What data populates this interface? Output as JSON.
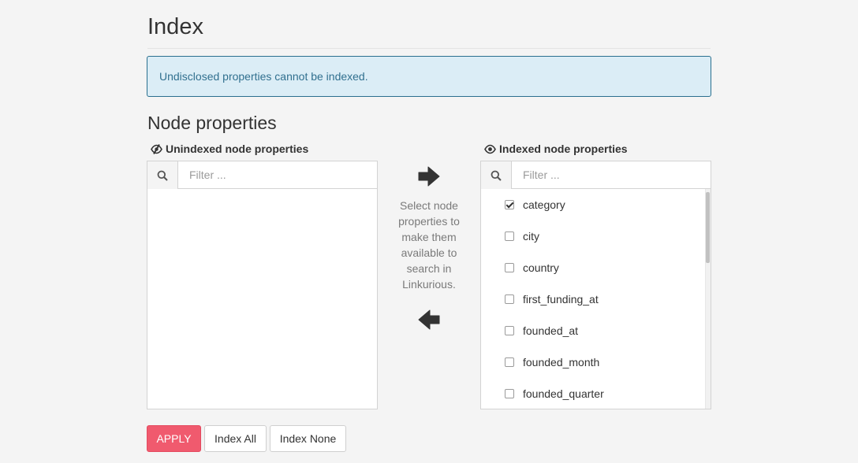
{
  "page": {
    "title": "Index"
  },
  "alert": {
    "text": "Undisclosed properties cannot be indexed."
  },
  "section": {
    "title": "Node properties"
  },
  "unindexed": {
    "heading": "Unindexed node properties",
    "filter_placeholder": "Filter ...",
    "filter_value": ""
  },
  "indexed": {
    "heading": "Indexed node properties",
    "filter_placeholder": "Filter ...",
    "filter_value": "",
    "items": [
      {
        "label": "category",
        "checked": true
      },
      {
        "label": "city",
        "checked": false
      },
      {
        "label": "country",
        "checked": false
      },
      {
        "label": "first_funding_at",
        "checked": false
      },
      {
        "label": "founded_at",
        "checked": false
      },
      {
        "label": "founded_month",
        "checked": false
      },
      {
        "label": "founded_quarter",
        "checked": false
      }
    ]
  },
  "transfer": {
    "help_text": "Select node properties to make them available to search in Linkurious.",
    "right_icon": "arrow-right-icon",
    "left_icon": "arrow-left-icon"
  },
  "buttons": {
    "apply": "APPLY",
    "index_all": "Index All",
    "index_none": "Index None"
  },
  "colors": {
    "primary": "#f05a6e",
    "alert_bg": "#dbedf6",
    "alert_text": "#31708f"
  }
}
